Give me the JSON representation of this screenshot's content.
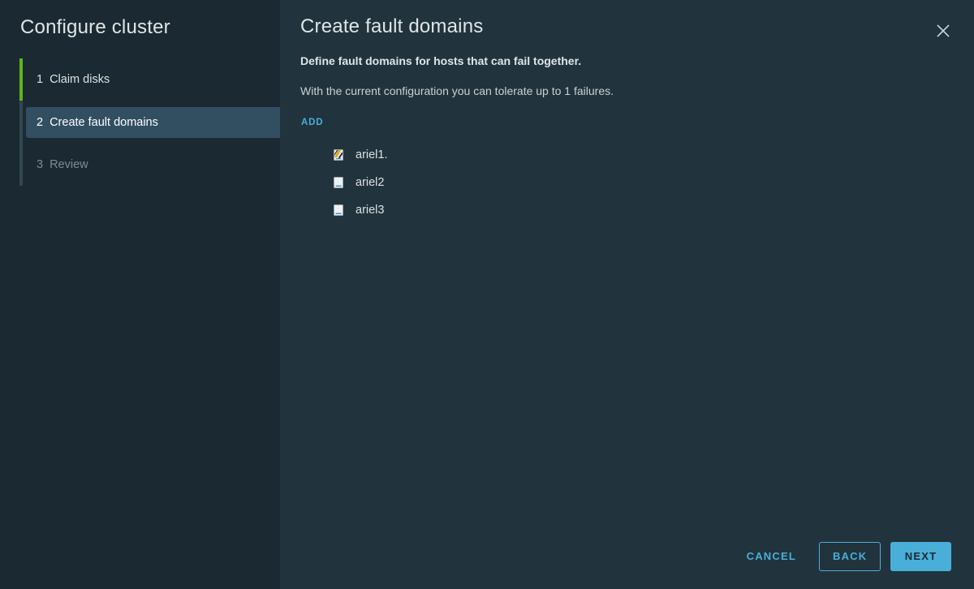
{
  "nav": {
    "title": "Configure cluster",
    "steps": [
      {
        "number": "1",
        "label": "Claim disks",
        "state": "completed"
      },
      {
        "number": "2",
        "label": "Create fault domains",
        "state": "current"
      },
      {
        "number": "3",
        "label": "Review",
        "state": "upcoming"
      }
    ]
  },
  "main": {
    "title": "Create fault domains",
    "subtitle": "Define fault domains for hosts that can fail together.",
    "info": "With the current configuration you can tolerate up to 1 failures.",
    "add_label": "ADD",
    "hosts": [
      {
        "label": "ariel1.",
        "icon": "host-warning-icon"
      },
      {
        "label": "ariel2",
        "icon": "host-icon"
      },
      {
        "label": "ariel3",
        "icon": "host-icon"
      }
    ]
  },
  "footer": {
    "cancel_label": "CANCEL",
    "back_label": "BACK",
    "next_label": "NEXT"
  },
  "colors": {
    "accent": "#49afd9",
    "completed": "#60b515",
    "nav_bg": "#1b2a32",
    "content_bg": "#21333c",
    "selected_step_bg": "#324f62"
  }
}
